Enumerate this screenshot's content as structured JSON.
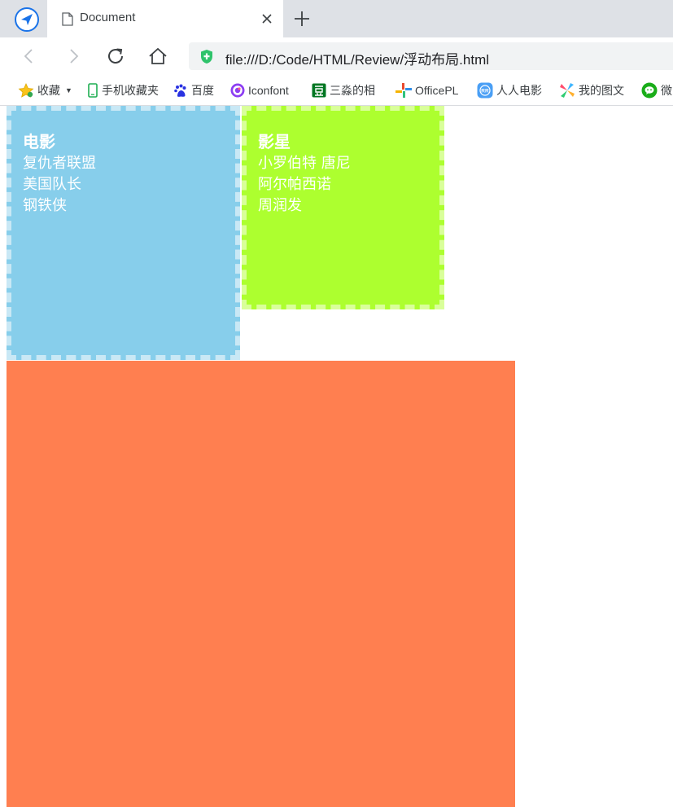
{
  "browser": {
    "tab_title": "Document",
    "address_url": "file:///D:/Code/HTML/Review/浮动布局.html"
  },
  "bookmarks": [
    {
      "label": "收藏",
      "icon": "star-icon"
    },
    {
      "label": "手机收藏夹",
      "icon": "mobile-icon"
    },
    {
      "label": "百度",
      "icon": "baidu-paw-icon"
    },
    {
      "label": "Iconfont",
      "icon": "iconfont-icon"
    },
    {
      "label": "三淼的相",
      "icon": "douban-icon"
    },
    {
      "label": "OfficePL",
      "icon": "officeplus-icon"
    },
    {
      "label": "人人电影",
      "icon": "rr-icon"
    },
    {
      "label": "我的图文",
      "icon": "pinwheel-icon"
    },
    {
      "label": "微",
      "icon": "wechat-icon"
    }
  ],
  "content": {
    "movies": {
      "title": "电影",
      "items": [
        "复仇者联盟",
        "美国队长",
        "钢铁侠"
      ]
    },
    "stars": {
      "title": "影星",
      "items": [
        "小罗伯特 唐尼",
        "阿尔帕西诺",
        "周润发"
      ]
    }
  },
  "colors": {
    "movies_bg": "#87ceeb",
    "stars_bg": "#adff2f",
    "block_bg": "#ff7f50"
  }
}
